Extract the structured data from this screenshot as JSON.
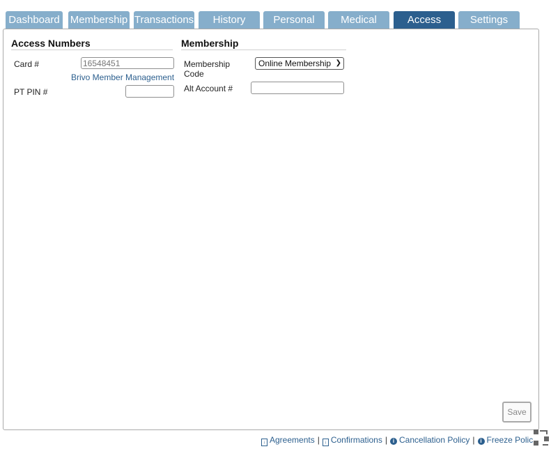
{
  "tabs": [
    {
      "label": "Dashboard",
      "active": false
    },
    {
      "label": "Membership",
      "active": false
    },
    {
      "label": "Transactions",
      "active": false
    },
    {
      "label": "History",
      "active": false
    },
    {
      "label": "Personal",
      "active": false
    },
    {
      "label": "Medical",
      "active": false
    },
    {
      "label": "Access",
      "active": true
    },
    {
      "label": "Settings",
      "active": false
    }
  ],
  "access_numbers": {
    "title": "Access Numbers",
    "card_label": "Card #",
    "card_placeholder": "16548451",
    "brivo_link": "Brivo Member Management",
    "pt_pin_label": "PT PIN #",
    "pt_pin_value": ""
  },
  "membership": {
    "title": "Membership",
    "code_label_line1": "Membership",
    "code_label_line2": "Code",
    "code_selected": "Online Membership",
    "alt_account_label": "Alt Account #",
    "alt_account_value": ""
  },
  "save_label": "Save",
  "footer": {
    "agreements": "Agreements",
    "confirmations": "Confirmations",
    "cancellation": "Cancellation Policy",
    "freeze": "Freeze Polic",
    "separator": "|"
  },
  "colors": {
    "tab_inactive": "#86aecb",
    "tab_active": "#2c5f8e",
    "link": "#2c5f8e"
  }
}
